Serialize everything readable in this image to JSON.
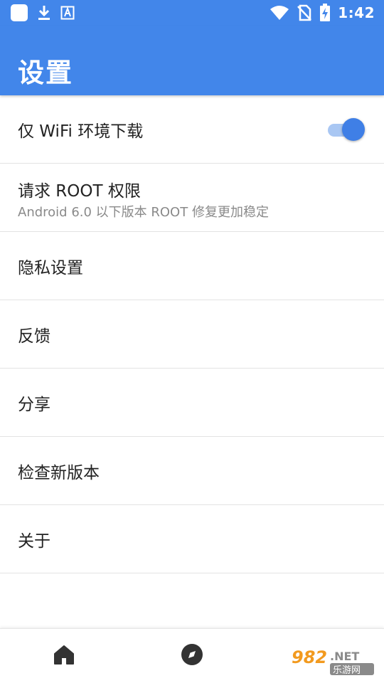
{
  "status_bar": {
    "time": "1:42",
    "left_icons": [
      "app-square-icon",
      "download-icon",
      "a-box-icon"
    ],
    "right_icons": [
      "wifi-icon",
      "no-sim-icon",
      "battery-charging-icon"
    ]
  },
  "app_bar": {
    "title": "设置"
  },
  "settings": {
    "items": [
      {
        "title": "仅 WiFi 环境下载",
        "toggle_on": true
      },
      {
        "title": "请求 ROOT 权限",
        "subtitle": "Android 6.0 以下版本 ROOT 修复更加稳定"
      },
      {
        "title": "隐私设置"
      },
      {
        "title": "反馈"
      },
      {
        "title": "分享"
      },
      {
        "title": "检查新版本"
      },
      {
        "title": "关于"
      }
    ]
  },
  "bottom_nav": {
    "items": [
      {
        "icon": "home-icon"
      },
      {
        "icon": "compass-icon"
      },
      {
        "icon": "third-tab-icon"
      }
    ]
  },
  "watermark": {
    "text_top": "982.NET",
    "text_bottom": "乐游网"
  },
  "colors": {
    "accent": "#4286ea",
    "toggle_thumb": "#3f7fe6",
    "toggle_track": "#a9c7f3",
    "text_primary": "#222222",
    "text_secondary": "#8a8a8a",
    "divider": "#e3e3e3"
  }
}
